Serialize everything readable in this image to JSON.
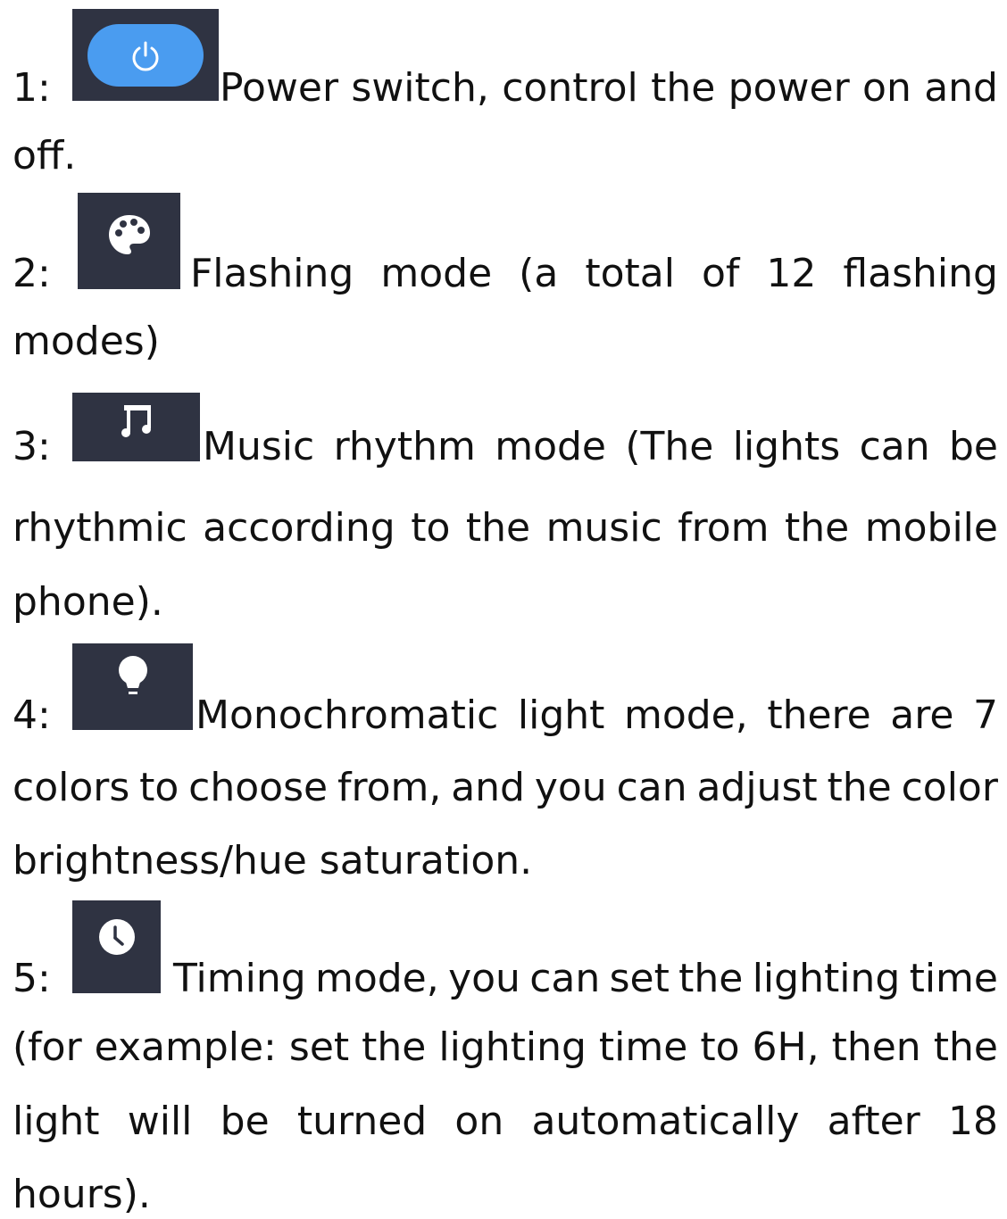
{
  "items": [
    {
      "number": "1:",
      "icon": "power-toggle-icon",
      "first_line": [
        "Power",
        "switch,",
        "control",
        "the",
        "power",
        "on",
        "and"
      ],
      "lines": [
        "off."
      ]
    },
    {
      "number": "2:",
      "icon": "palette-icon",
      "first_line": [
        "Flashing",
        "mode",
        "(a",
        "total",
        "of",
        "12",
        "flashing"
      ],
      "lines": [
        "modes)"
      ]
    },
    {
      "number": "3:",
      "icon": "music-note-icon",
      "first_line": [
        "Music",
        "rhythm",
        "mode",
        "(The",
        "lights",
        "can",
        "be"
      ],
      "lines": [
        [
          "rhythmic",
          "according",
          "to",
          "the",
          "music",
          "from",
          "the",
          "mobile"
        ],
        "phone)."
      ]
    },
    {
      "number": "4:",
      "icon": "light-bulb-icon",
      "first_line": [
        "Monochromatic",
        "light",
        "mode,",
        "there",
        "are",
        "7"
      ],
      "lines": [
        [
          "colors",
          "to",
          "choose",
          "from,",
          "and",
          "you",
          "can",
          "adjust",
          "the",
          "color"
        ],
        "brightness/hue saturation."
      ]
    },
    {
      "number": "5:",
      "icon": "clock-icon",
      "first_line": [
        "Timing",
        "mode,",
        "you",
        "can",
        "set",
        "the",
        "lighting",
        "time"
      ],
      "lines": [
        [
          "(for",
          "example:",
          "set",
          "the",
          "lighting",
          "time",
          "to",
          "6H,",
          "then",
          "the"
        ],
        [
          "light",
          "will",
          "be",
          "turned",
          "on",
          "automatically",
          "after",
          "18"
        ],
        "hours)."
      ]
    }
  ],
  "colors": {
    "icon_box": "#2f3342",
    "power_pill": "#4a9cf0",
    "icon_glyph": "#ffffff",
    "text": "#111111"
  }
}
